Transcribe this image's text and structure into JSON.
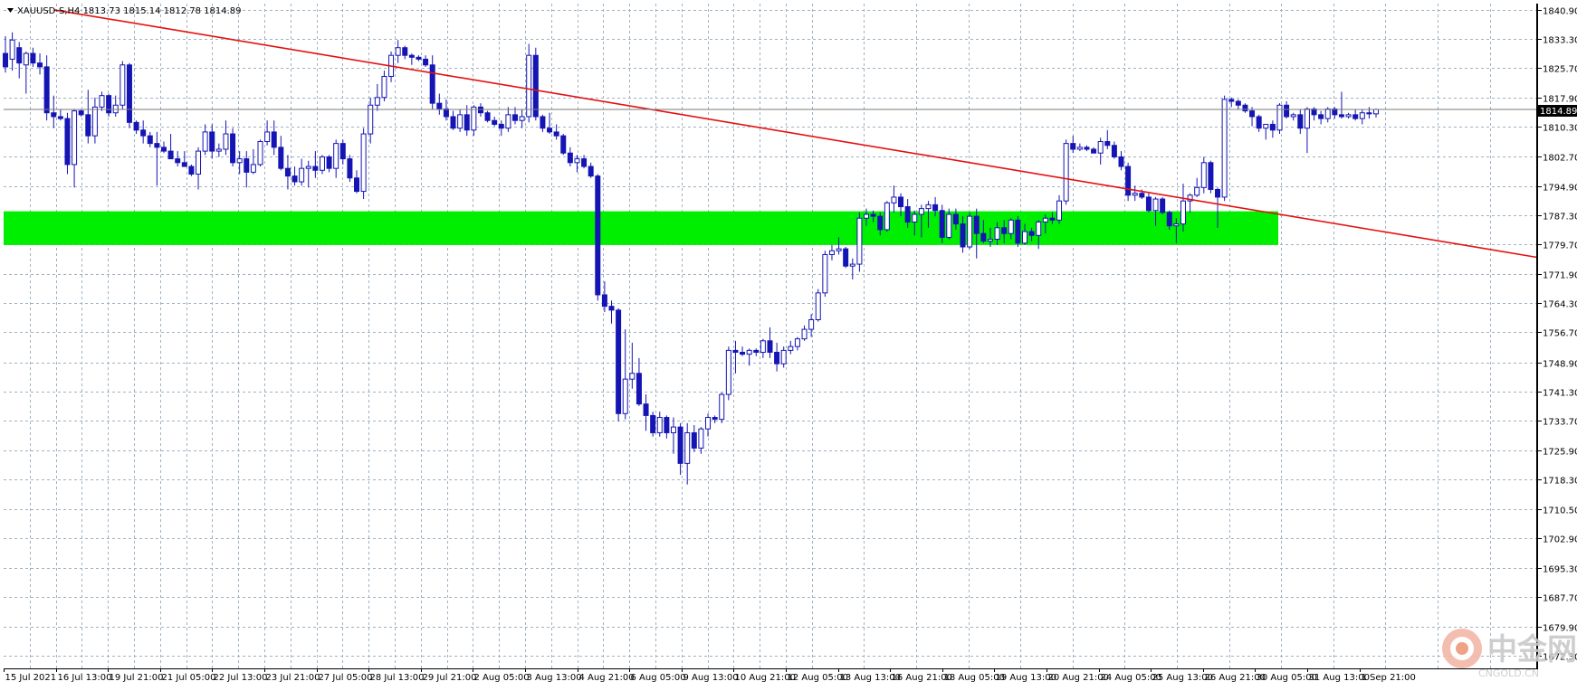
{
  "header": {
    "text": "XAUUSD-S,H4  1813.73 1815.14 1812.78 1814.89"
  },
  "price_label": "1814.89",
  "watermark": {
    "chinese": "中金网",
    "latin": "CNGOLD.CN"
  },
  "colors": {
    "bull_candle": "#1515b4",
    "bear_candle": "#1515b4",
    "grid": "#9fb2c3",
    "trendline": "#e31010",
    "zone": "#00ee00",
    "price_line": "#7a7a7a"
  },
  "chart_data": {
    "type": "candlestick",
    "symbol": "XAUUSD-S",
    "timeframe": "H4",
    "y_axis": {
      "range": [
        1669.0,
        1842.5
      ],
      "ticks": [
        "1840.90",
        "1833.30",
        "1825.70",
        "1817.90",
        "1810.30",
        "1802.70",
        "1794.90",
        "1787.30",
        "1779.70",
        "1771.90",
        "1764.30",
        "1756.70",
        "1748.90",
        "1741.30",
        "1733.70",
        "1725.90",
        "1718.30",
        "1710.50",
        "1702.90",
        "1695.30",
        "1687.70",
        "1679.90",
        "1672.30"
      ]
    },
    "x_axis": {
      "ticks": [
        "15 Jul 2021",
        "16 Jul 13:00",
        "19 Jul 21:00",
        "21 Jul 05:00",
        "22 Jul 13:00",
        "23 Jul 21:00",
        "27 Jul 05:00",
        "28 Jul 13:00",
        "29 Jul 21:00",
        "2 Aug 05:00",
        "3 Aug 13:00",
        "4 Aug 21:00",
        "6 Aug 05:00",
        "9 Aug 13:00",
        "10 Aug 21:00",
        "12 Aug 05:00",
        "13 Aug 13:00",
        "16 Aug 21:00",
        "18 Aug 05:00",
        "19 Aug 13:00",
        "20 Aug 21:00",
        "24 Aug 05:00",
        "25 Aug 13:00",
        "26 Aug 21:00",
        "30 Aug 05:00",
        "31 Aug 13:00",
        "1 Sep 21:00"
      ]
    },
    "grid": true,
    "current_price": 1814.89,
    "support_zone": [
      1779.5,
      1788.3
    ],
    "trendline": {
      "start": [
        0,
        1843.0
      ],
      "end": [
        260,
        1765.0
      ]
    },
    "candles_ohlc": [
      [
        1829.5,
        1834.0,
        1824.5,
        1826.0
      ],
      [
        1828.0,
        1835.0,
        1825.0,
        1833.0
      ],
      [
        1831.0,
        1832.5,
        1823.0,
        1827.0
      ],
      [
        1826.5,
        1830.0,
        1819.0,
        1829.5
      ],
      [
        1829.5,
        1831.0,
        1826.0,
        1827.0
      ],
      [
        1827.0,
        1829.5,
        1824.0,
        1826.0
      ],
      [
        1826.0,
        1829.0,
        1812.0,
        1814.0
      ],
      [
        1814.0,
        1818.5,
        1810.0,
        1813.0
      ],
      [
        1813.0,
        1815.0,
        1812.0,
        1812.5
      ],
      [
        1812.5,
        1814.0,
        1798.0,
        1800.5
      ],
      [
        1800.5,
        1815.0,
        1794.5,
        1814.5
      ],
      [
        1814.5,
        1815.0,
        1813.0,
        1813.5
      ],
      [
        1813.5,
        1820.0,
        1806.0,
        1808.0
      ],
      [
        1808.0,
        1818.0,
        1806.0,
        1815.5
      ],
      [
        1815.5,
        1819.5,
        1814.5,
        1818.5
      ],
      [
        1818.5,
        1819.0,
        1813.0,
        1814.0
      ],
      [
        1814.0,
        1818.5,
        1813.0,
        1816.0
      ],
      [
        1816.0,
        1827.5,
        1815.0,
        1826.5
      ],
      [
        1826.5,
        1827.0,
        1810.0,
        1811.5
      ],
      [
        1811.5,
        1812.0,
        1808.5,
        1809.5
      ],
      [
        1809.5,
        1812.0,
        1806.0,
        1808.0
      ],
      [
        1808.0,
        1809.0,
        1805.0,
        1806.0
      ],
      [
        1806.0,
        1809.0,
        1795.0,
        1805.0
      ],
      [
        1805.0,
        1806.5,
        1803.5,
        1804.0
      ],
      [
        1804.0,
        1808.5,
        1802.0,
        1802.0
      ],
      [
        1802.0,
        1804.0,
        1800.0,
        1801.0
      ],
      [
        1801.0,
        1804.0,
        1800.0,
        1800.0
      ],
      [
        1800.0,
        1800.5,
        1797.5,
        1798.0
      ],
      [
        1798.0,
        1805.0,
        1794.0,
        1804.0
      ],
      [
        1804.0,
        1811.0,
        1803.0,
        1809.0
      ],
      [
        1809.0,
        1811.0,
        1802.0,
        1804.0
      ],
      [
        1804.0,
        1806.0,
        1802.5,
        1804.5
      ],
      [
        1804.5,
        1812.0,
        1803.0,
        1808.5
      ],
      [
        1808.5,
        1810.0,
        1800.0,
        1801.0
      ],
      [
        1801.0,
        1804.0,
        1798.0,
        1802.0
      ],
      [
        1802.0,
        1804.0,
        1794.5,
        1798.5
      ],
      [
        1798.5,
        1804.5,
        1798.0,
        1800.5
      ],
      [
        1800.5,
        1807.0,
        1800.0,
        1806.5
      ],
      [
        1806.5,
        1812.0,
        1805.5,
        1809.0
      ],
      [
        1809.0,
        1812.0,
        1803.0,
        1805.0
      ],
      [
        1805.0,
        1808.0,
        1799.0,
        1799.5
      ],
      [
        1799.5,
        1803.0,
        1794.0,
        1797.5
      ],
      [
        1797.5,
        1800.0,
        1795.0,
        1796.0
      ],
      [
        1796.0,
        1802.0,
        1795.0,
        1799.5
      ],
      [
        1799.5,
        1801.5,
        1794.5,
        1800.0
      ],
      [
        1800.0,
        1804.0,
        1797.0,
        1799.0
      ],
      [
        1799.0,
        1803.0,
        1798.0,
        1802.5
      ],
      [
        1802.5,
        1803.0,
        1798.5,
        1799.5
      ],
      [
        1799.5,
        1807.0,
        1797.0,
        1806.0
      ],
      [
        1806.0,
        1807.0,
        1800.5,
        1802.0
      ],
      [
        1802.0,
        1803.0,
        1796.0,
        1797.0
      ],
      [
        1797.0,
        1799.0,
        1793.0,
        1793.5
      ],
      [
        1793.5,
        1810.0,
        1791.5,
        1808.5
      ],
      [
        1808.5,
        1818.0,
        1806.0,
        1816.0
      ],
      [
        1816.0,
        1821.5,
        1814.5,
        1818.0
      ],
      [
        1818.0,
        1825.0,
        1817.0,
        1823.5
      ],
      [
        1823.5,
        1830.0,
        1822.0,
        1829.0
      ],
      [
        1829.0,
        1833.0,
        1827.0,
        1831.0
      ],
      [
        1831.0,
        1831.5,
        1828.0,
        1829.0
      ],
      [
        1829.0,
        1829.5,
        1826.5,
        1828.5
      ],
      [
        1828.5,
        1829.0,
        1827.5,
        1828.0
      ],
      [
        1828.0,
        1829.0,
        1826.0,
        1826.5
      ],
      [
        1826.5,
        1829.0,
        1815.0,
        1816.5
      ],
      [
        1816.5,
        1819.0,
        1813.5,
        1815.0
      ],
      [
        1815.0,
        1817.5,
        1812.0,
        1813.0
      ],
      [
        1813.0,
        1814.5,
        1809.5,
        1810.0
      ],
      [
        1810.0,
        1815.0,
        1809.0,
        1813.5
      ],
      [
        1813.5,
        1816.0,
        1808.0,
        1809.5
      ],
      [
        1809.5,
        1816.0,
        1808.0,
        1815.5
      ],
      [
        1815.5,
        1816.5,
        1813.0,
        1814.0
      ],
      [
        1814.0,
        1814.5,
        1811.5,
        1812.0
      ],
      [
        1812.0,
        1813.0,
        1810.5,
        1811.0
      ],
      [
        1811.0,
        1812.0,
        1808.0,
        1810.0
      ],
      [
        1810.0,
        1815.5,
        1809.0,
        1813.5
      ],
      [
        1813.5,
        1815.5,
        1811.0,
        1812.0
      ],
      [
        1812.0,
        1815.0,
        1810.0,
        1813.0
      ],
      [
        1813.0,
        1832.0,
        1811.5,
        1829.0
      ],
      [
        1829.0,
        1831.0,
        1812.0,
        1813.0
      ],
      [
        1813.0,
        1813.5,
        1809.0,
        1810.0
      ],
      [
        1810.0,
        1814.0,
        1808.5,
        1809.0
      ],
      [
        1809.0,
        1811.0,
        1807.0,
        1808.0
      ],
      [
        1808.0,
        1808.5,
        1803.0,
        1803.5
      ],
      [
        1803.5,
        1805.0,
        1800.0,
        1801.0
      ],
      [
        1801.0,
        1803.0,
        1798.5,
        1802.0
      ],
      [
        1802.0,
        1803.0,
        1799.5,
        1800.0
      ],
      [
        1800.0,
        1801.0,
        1797.0,
        1797.5
      ],
      [
        1797.5,
        1798.0,
        1765.0,
        1766.5
      ],
      [
        1766.5,
        1770.0,
        1762.0,
        1763.5
      ],
      [
        1763.5,
        1765.0,
        1759.0,
        1762.5
      ],
      [
        1762.5,
        1763.0,
        1733.5,
        1735.5
      ],
      [
        1735.5,
        1757.5,
        1734.0,
        1744.5
      ],
      [
        1744.5,
        1754.0,
        1742.0,
        1746.0
      ],
      [
        1746.0,
        1750.0,
        1737.5,
        1738.0
      ],
      [
        1738.0,
        1740.5,
        1731.0,
        1735.0
      ],
      [
        1735.0,
        1736.0,
        1729.5,
        1730.5
      ],
      [
        1730.5,
        1736.0,
        1729.5,
        1734.5
      ],
      [
        1734.5,
        1735.0,
        1729.0,
        1730.5
      ],
      [
        1730.5,
        1734.5,
        1725.0,
        1732.0
      ],
      [
        1732.0,
        1733.0,
        1719.5,
        1722.5
      ],
      [
        1722.5,
        1733.0,
        1717.0,
        1730.5
      ],
      [
        1730.5,
        1732.5,
        1725.5,
        1726.5
      ],
      [
        1726.5,
        1732.0,
        1725.0,
        1731.5
      ],
      [
        1731.5,
        1735.5,
        1729.5,
        1734.5
      ],
      [
        1734.5,
        1735.0,
        1733.0,
        1734.0
      ],
      [
        1734.0,
        1741.0,
        1733.0,
        1740.5
      ],
      [
        1740.5,
        1753.0,
        1739.0,
        1752.0
      ],
      [
        1752.0,
        1754.5,
        1746.0,
        1751.5
      ],
      [
        1751.5,
        1753.0,
        1750.5,
        1751.0
      ],
      [
        1751.0,
        1752.5,
        1748.0,
        1752.0
      ],
      [
        1752.0,
        1752.5,
        1750.5,
        1751.5
      ],
      [
        1751.5,
        1755.0,
        1750.0,
        1754.5
      ],
      [
        1754.5,
        1758.0,
        1750.0,
        1751.5
      ],
      [
        1751.5,
        1754.0,
        1746.5,
        1748.5
      ],
      [
        1748.5,
        1753.0,
        1747.5,
        1752.0
      ],
      [
        1752.0,
        1754.5,
        1751.0,
        1753.0
      ],
      [
        1753.0,
        1755.5,
        1752.0,
        1755.0
      ],
      [
        1755.0,
        1758.5,
        1754.5,
        1757.5
      ],
      [
        1757.5,
        1761.5,
        1755.5,
        1760.0
      ],
      [
        1760.0,
        1768.0,
        1759.5,
        1767.0
      ],
      [
        1767.0,
        1778.0,
        1766.0,
        1777.0
      ],
      [
        1777.0,
        1779.5,
        1775.5,
        1778.0
      ],
      [
        1778.0,
        1781.5,
        1777.0,
        1778.5
      ],
      [
        1778.5,
        1779.0,
        1773.5,
        1774.0
      ],
      [
        1774.0,
        1776.0,
        1770.5,
        1774.5
      ],
      [
        1774.5,
        1788.0,
        1772.5,
        1786.5
      ],
      [
        1786.5,
        1789.0,
        1784.5,
        1787.5
      ],
      [
        1787.5,
        1788.5,
        1785.5,
        1787.0
      ],
      [
        1787.0,
        1788.0,
        1782.0,
        1783.5
      ],
      [
        1783.5,
        1791.0,
        1783.0,
        1790.5
      ],
      [
        1790.5,
        1795.0,
        1788.0,
        1792.0
      ],
      [
        1792.0,
        1793.0,
        1787.0,
        1789.5
      ],
      [
        1789.5,
        1791.5,
        1784.0,
        1785.5
      ],
      [
        1785.5,
        1788.5,
        1782.0,
        1787.5
      ],
      [
        1787.5,
        1790.0,
        1781.5,
        1789.0
      ],
      [
        1789.0,
        1791.0,
        1784.0,
        1790.0
      ],
      [
        1790.0,
        1792.0,
        1787.0,
        1788.5
      ],
      [
        1788.5,
        1790.0,
        1780.0,
        1781.5
      ],
      [
        1781.5,
        1789.0,
        1781.0,
        1787.5
      ],
      [
        1787.5,
        1789.0,
        1783.5,
        1785.0
      ],
      [
        1785.0,
        1787.0,
        1777.5,
        1779.0
      ],
      [
        1779.0,
        1788.0,
        1778.5,
        1787.0
      ],
      [
        1787.0,
        1789.0,
        1776.0,
        1782.5
      ],
      [
        1782.5,
        1786.0,
        1780.0,
        1780.5
      ],
      [
        1780.5,
        1784.0,
        1779.0,
        1781.0
      ],
      [
        1781.0,
        1785.5,
        1779.5,
        1784.0
      ],
      [
        1784.0,
        1786.0,
        1780.0,
        1782.5
      ],
      [
        1782.5,
        1786.5,
        1781.0,
        1786.0
      ],
      [
        1786.0,
        1787.0,
        1779.0,
        1780.0
      ],
      [
        1780.0,
        1785.0,
        1779.5,
        1783.0
      ],
      [
        1783.0,
        1784.0,
        1780.5,
        1782.0
      ],
      [
        1782.0,
        1786.0,
        1778.5,
        1785.5
      ],
      [
        1785.5,
        1787.5,
        1782.5,
        1786.5
      ],
      [
        1786.5,
        1788.0,
        1785.0,
        1786.0
      ],
      [
        1786.0,
        1792.5,
        1785.0,
        1791.0
      ],
      [
        1791.0,
        1807.0,
        1790.0,
        1806.0
      ],
      [
        1806.0,
        1808.0,
        1803.5,
        1804.5
      ],
      [
        1804.5,
        1806.0,
        1804.0,
        1805.0
      ],
      [
        1805.0,
        1805.5,
        1804.0,
        1804.5
      ],
      [
        1804.5,
        1805.0,
        1803.5,
        1803.5
      ],
      [
        1803.5,
        1807.5,
        1800.5,
        1806.5
      ],
      [
        1806.5,
        1809.5,
        1804.5,
        1805.5
      ],
      [
        1805.5,
        1806.5,
        1802.0,
        1802.5
      ],
      [
        1802.5,
        1804.0,
        1799.0,
        1800.0
      ],
      [
        1800.0,
        1801.0,
        1791.0,
        1792.5
      ],
      [
        1792.5,
        1795.0,
        1791.0,
        1793.0
      ],
      [
        1793.0,
        1794.0,
        1791.5,
        1792.0
      ],
      [
        1792.0,
        1793.0,
        1788.0,
        1788.5
      ],
      [
        1788.5,
        1792.0,
        1784.5,
        1791.5
      ],
      [
        1791.5,
        1792.0,
        1787.5,
        1788.0
      ],
      [
        1788.0,
        1788.5,
        1783.5,
        1784.5
      ],
      [
        1784.5,
        1786.5,
        1780.0,
        1785.0
      ],
      [
        1785.0,
        1795.5,
        1783.0,
        1791.0
      ],
      [
        1791.0,
        1793.0,
        1788.0,
        1792.5
      ],
      [
        1792.5,
        1797.0,
        1792.0,
        1794.5
      ],
      [
        1794.5,
        1802.5,
        1793.0,
        1801.0
      ],
      [
        1801.0,
        1801.5,
        1793.0,
        1794.0
      ],
      [
        1794.0,
        1794.5,
        1784.0,
        1792.0
      ],
      [
        1792.0,
        1818.5,
        1791.0,
        1817.5
      ],
      [
        1817.5,
        1818.0,
        1815.5,
        1817.0
      ],
      [
        1817.0,
        1817.5,
        1815.0,
        1816.0
      ],
      [
        1816.0,
        1816.5,
        1814.0,
        1814.5
      ],
      [
        1814.5,
        1815.5,
        1810.5,
        1813.0
      ],
      [
        1813.0,
        1813.5,
        1809.0,
        1810.0
      ],
      [
        1810.0,
        1811.0,
        1807.0,
        1811.0
      ],
      [
        1811.0,
        1812.0,
        1807.5,
        1809.5
      ],
      [
        1809.5,
        1816.5,
        1808.5,
        1816.0
      ],
      [
        1816.0,
        1817.0,
        1812.5,
        1813.0
      ],
      [
        1813.0,
        1814.0,
        1812.0,
        1813.5
      ],
      [
        1813.5,
        1815.0,
        1808.5,
        1810.0
      ],
      [
        1810.0,
        1815.5,
        1803.5,
        1815.0
      ],
      [
        1815.0,
        1815.5,
        1812.0,
        1813.5
      ],
      [
        1813.5,
        1814.5,
        1811.0,
        1812.5
      ],
      [
        1812.5,
        1815.5,
        1811.5,
        1815.0
      ],
      [
        1815.0,
        1815.5,
        1812.5,
        1813.5
      ],
      [
        1813.5,
        1819.5,
        1812.5,
        1813.0
      ],
      [
        1813.0,
        1814.0,
        1812.5,
        1813.5
      ],
      [
        1813.5,
        1815.0,
        1812.0,
        1812.5
      ],
      [
        1812.5,
        1815.0,
        1811.0,
        1814.0
      ],
      [
        1814.0,
        1815.5,
        1812.5,
        1813.73
      ],
      [
        1813.73,
        1815.14,
        1812.78,
        1814.89
      ]
    ]
  }
}
